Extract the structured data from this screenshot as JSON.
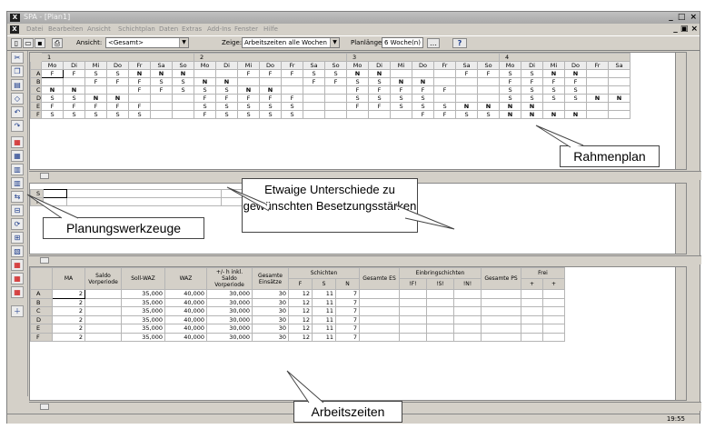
{
  "window": {
    "title": "SPA - [Plan1]"
  },
  "menu": [
    "Datei",
    "Bearbeiten",
    "Ansicht",
    "Schichtplan",
    "Daten",
    "Extras",
    "Add-Ins",
    "Fenster",
    "Hilfe"
  ],
  "toolbar": {
    "ansicht_label": "Ansicht:",
    "ansicht_value": "<Gesamt>",
    "zeige_label": "Zeige:",
    "zeige_value": "Arbeitszeiten alle Wochen",
    "planlaenge_label": "Planlänge:",
    "planlaenge_value": "6 Woche(n)"
  },
  "plan": {
    "weeks": [
      "1",
      "2",
      "3",
      "4"
    ],
    "days": [
      "Mo",
      "Di",
      "Mi",
      "Do",
      "Fr",
      "Sa",
      "So",
      "Mo",
      "Di",
      "Mi",
      "Do",
      "Fr",
      "Sa",
      "So",
      "Mo",
      "Di",
      "Mi",
      "Do",
      "Fr",
      "Sa",
      "So",
      "Mo",
      "Di",
      "Mi",
      "Do",
      "Fr",
      "Sa"
    ],
    "rows": [
      {
        "label": "A",
        "cells": [
          "F",
          "F",
          "S",
          "S",
          "N",
          "N",
          "N",
          "",
          "",
          "F",
          "F",
          "F",
          "S",
          "S",
          "N",
          "N",
          "",
          "",
          "",
          "F",
          "F",
          "S",
          "S",
          "N",
          "N",
          "",
          ""
        ]
      },
      {
        "label": "B",
        "cells": [
          "",
          "",
          "F",
          "F",
          "F",
          "S",
          "S",
          "N",
          "N",
          "",
          "",
          "",
          "F",
          "F",
          "S",
          "S",
          "N",
          "N",
          "",
          "",
          "",
          "F",
          "F",
          "F",
          "F",
          "",
          ""
        ]
      },
      {
        "label": "C",
        "cells": [
          "N",
          "N",
          "",
          "",
          "F",
          "F",
          "S",
          "S",
          "S",
          "N",
          "N",
          "",
          "",
          "",
          "F",
          "F",
          "F",
          "F",
          "F",
          "",
          "",
          "S",
          "S",
          "S",
          "S",
          "",
          ""
        ]
      },
      {
        "label": "D",
        "cells": [
          "S",
          "S",
          "N",
          "N",
          "",
          "",
          "",
          "F",
          "F",
          "F",
          "F",
          "F",
          "",
          "",
          "S",
          "S",
          "S",
          "S",
          "",
          "",
          "",
          "S",
          "S",
          "S",
          "S",
          "N",
          "N"
        ]
      },
      {
        "label": "E",
        "cells": [
          "F",
          "F",
          "F",
          "F",
          "F",
          "",
          "",
          "S",
          "S",
          "S",
          "S",
          "S",
          "",
          "",
          "F",
          "F",
          "S",
          "S",
          "S",
          "N",
          "N",
          "N",
          "N",
          "",
          "",
          "",
          ""
        ]
      },
      {
        "label": "F",
        "cells": [
          "S",
          "S",
          "S",
          "S",
          "S",
          "",
          "",
          "F",
          "S",
          "S",
          "S",
          "S",
          "",
          "",
          "",
          "",
          "",
          "F",
          "F",
          "S",
          "S",
          "N",
          "N",
          "N",
          "N",
          "",
          ""
        ]
      }
    ]
  },
  "lower_rows": [
    "S",
    "F"
  ],
  "stats": {
    "headers": {
      "ma": "MA",
      "saldo": "Saldo Vorperiode",
      "soll": "Soll-WAZ",
      "waz": "WAZ",
      "plusminus": "+/- h inkl. Saldo Vorperiode",
      "einsaetze": "Gesamte Einsätze",
      "schichten": "Schichten",
      "f": "F",
      "s": "S",
      "n": "N",
      "es": "Gesamte ES",
      "einbring": "Einbringschichten",
      "e_f": "!F!",
      "e_s": "!S!",
      "e_n": "!N!",
      "ps": "Gesamte PS",
      "frei": "Frei"
    },
    "rows": [
      {
        "label": "A",
        "ma": "2",
        "soll": "35,000",
        "waz": "40,000",
        "pm": "30,000",
        "ein": "30",
        "f": "12",
        "s": "11",
        "n": "7"
      },
      {
        "label": "B",
        "ma": "2",
        "soll": "35,000",
        "waz": "40,000",
        "pm": "30,000",
        "ein": "30",
        "f": "12",
        "s": "11",
        "n": "7"
      },
      {
        "label": "C",
        "ma": "2",
        "soll": "35,000",
        "waz": "40,000",
        "pm": "30,000",
        "ein": "30",
        "f": "12",
        "s": "11",
        "n": "7"
      },
      {
        "label": "D",
        "ma": "2",
        "soll": "35,000",
        "waz": "40,000",
        "pm": "30,000",
        "ein": "30",
        "f": "12",
        "s": "11",
        "n": "7"
      },
      {
        "label": "E",
        "ma": "2",
        "soll": "35,000",
        "waz": "40,000",
        "pm": "30,000",
        "ein": "30",
        "f": "12",
        "s": "11",
        "n": "7"
      },
      {
        "label": "F",
        "ma": "2",
        "soll": "35,000",
        "waz": "40,000",
        "pm": "30,000",
        "ein": "30",
        "f": "12",
        "s": "11",
        "n": "7"
      }
    ]
  },
  "callouts": {
    "rahmenplan": "Rahmenplan",
    "unterschiede": "Etwaige Unterschiede zu gewünschten Besetzungsstärken",
    "werkzeuge": "Planungswerkzeuge",
    "arbeitszeiten": "Arbeitszeiten"
  },
  "status": {
    "time": "19:55"
  }
}
